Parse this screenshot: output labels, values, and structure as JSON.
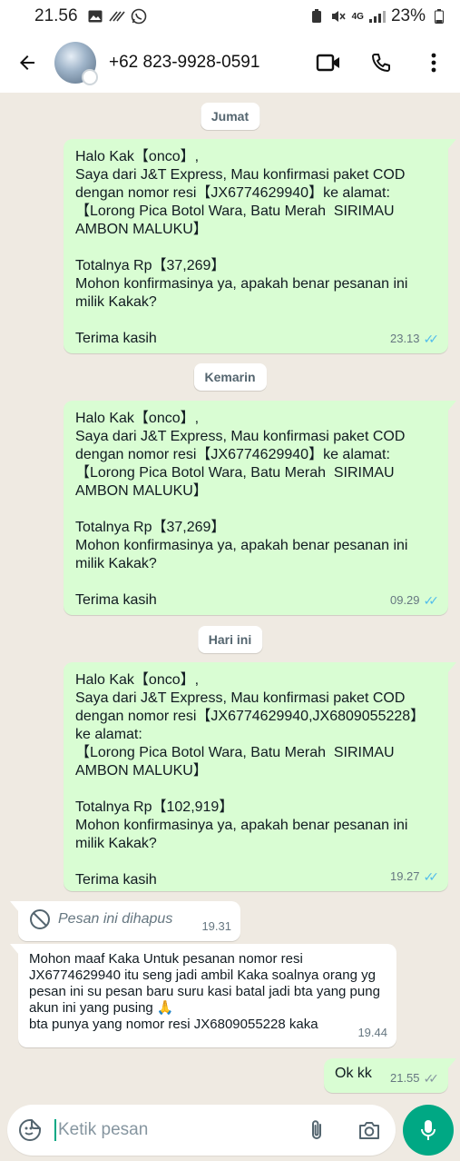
{
  "status_bar": {
    "time": "21.56",
    "network": "4G",
    "battery": "23%"
  },
  "header": {
    "contact": "+62 823-9928-0591"
  },
  "dates": {
    "d1": "Jumat",
    "d2": "Kemarin",
    "d3": "Hari ini"
  },
  "messages": {
    "m1": {
      "text": "Halo Kak【onco】,\nSaya dari J&T Express, Mau konfirmasi paket COD dengan nomor resi【JX6774629940】ke alamat:\n【Lorong Pica Botol Wara, Batu Merah  SIRIMAU AMBON MALUKU】\n\nTotalnya Rp【37,269】\nMohon konfirmasinya ya, apakah benar pesanan ini milik Kakak?\n\nTerima kasih",
      "time": "23.13"
    },
    "m2": {
      "text": "Halo Kak【onco】,\nSaya dari J&T Express, Mau konfirmasi paket COD dengan nomor resi【JX6774629940】ke alamat:\n【Lorong Pica Botol Wara, Batu Merah  SIRIMAU AMBON MALUKU】\n\nTotalnya Rp【37,269】\nMohon konfirmasinya ya, apakah benar pesanan ini milik Kakak?\n\nTerima kasih",
      "time": "09.29"
    },
    "m3": {
      "text": "Halo Kak【onco】,\nSaya dari J&T Express, Mau konfirmasi paket COD dengan nomor resi【JX6774629940,JX6809055228】ke alamat:\n【Lorong Pica Botol Wara, Batu Merah  SIRIMAU AMBON MALUKU】\n\nTotalnya Rp【102,919】\nMohon konfirmasinya ya, apakah benar pesanan ini milik Kakak?\n\nTerima kasih",
      "time": "19.27"
    },
    "m4": {
      "text": "Pesan ini dihapus",
      "time": "19.31"
    },
    "m5": {
      "text": "Mohon maaf Kaka Untuk pesanan nomor resi JX6774629940 itu seng jadi ambil Kaka soalnya orang yg pesan ini su pesan baru suru kasi batal jadi bta yang pung akun ini yang pusing 🙏\nbta punya yang nomor resi JX6809055228 kaka",
      "time": "19.44"
    },
    "m6": {
      "text": "Ok kk",
      "time": "21.55"
    }
  },
  "composer": {
    "placeholder": "Ketik pesan"
  },
  "colors": {
    "accent": "#00a884",
    "outgoing_bubble": "#d9fdd3",
    "read_ticks": "#53bdeb"
  },
  "icons": [
    "back-arrow-icon",
    "video-call-icon",
    "phone-icon",
    "more-icon",
    "sticker-icon",
    "attach-icon",
    "camera-icon",
    "mic-icon",
    "deleted-icon"
  ]
}
